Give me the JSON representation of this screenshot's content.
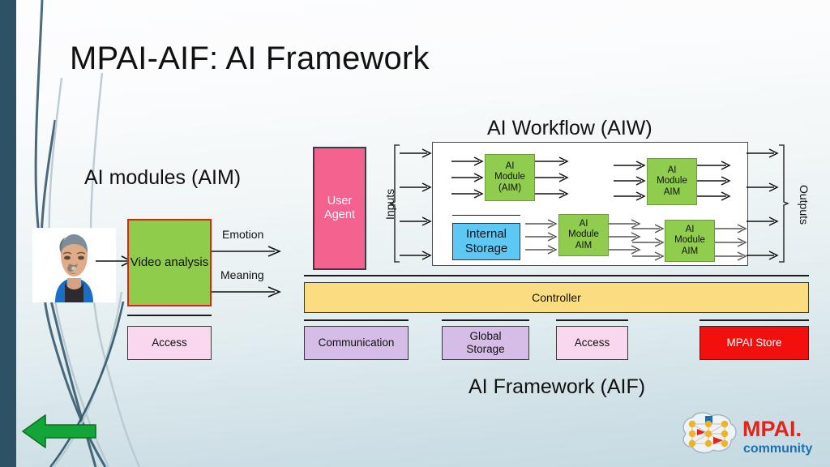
{
  "slide": {
    "title": "MPAI-AIF: AI Framework",
    "background_top_color": "#fdfdfe",
    "background_bottom_color": "#c4d9e1",
    "left_bar_color": "#2d5266"
  },
  "headings": {
    "ai_modules": "AI modules (AIM)",
    "ai_workflow": "AI Workflow (AIW)",
    "ai_framework": "AI Framework (AIF)"
  },
  "left_panel": {
    "video_box": "Video analysis",
    "output_labels": [
      "Emotion",
      "Meaning"
    ],
    "access_box": "Access",
    "avatar_name": "person-avatar"
  },
  "user_agent": {
    "label": "User Agent",
    "color": "#f4628f"
  },
  "workflow": {
    "inputs_label": "Inputs",
    "outputs_label": "Outputs",
    "modules": [
      {
        "lines": [
          "AI",
          "Module",
          "(AIM)"
        ]
      },
      {
        "lines": [
          "AI",
          "Module",
          "AIM"
        ]
      },
      {
        "lines": [
          "AI",
          "Module",
          "AIM"
        ]
      },
      {
        "lines": [
          "AI",
          "Module",
          "AIM"
        ]
      }
    ],
    "internal_storage": [
      "Internal",
      "Storage"
    ],
    "module_color": "#90cc4e",
    "storage_color": "#5ec8f5"
  },
  "framework": {
    "controller": "Controller",
    "services": [
      {
        "lines": [
          "Communication"
        ],
        "color": "#d6bde8"
      },
      {
        "lines": [
          "Global",
          "Storage"
        ],
        "color": "#d6bde8"
      },
      {
        "lines": [
          "Access"
        ],
        "color": "#f9d7ef"
      },
      {
        "lines": [
          "MPAI Store"
        ],
        "color": "#f40f0f"
      }
    ]
  },
  "logo": {
    "brand": "MPAI.",
    "tagline": "community",
    "brand_color": "#e2231a",
    "tagline_color": "#1f6fb5"
  },
  "nav": {
    "back_arrow": "green-left-arrow"
  }
}
